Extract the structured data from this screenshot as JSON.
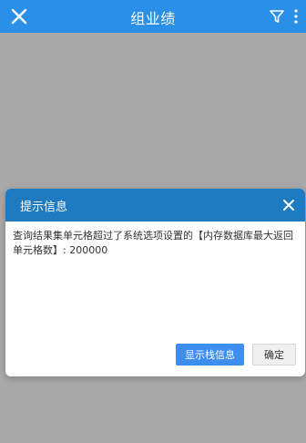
{
  "header": {
    "title": "组业绩",
    "background_color": "#2a8fe6",
    "left_icon": "close-icon",
    "right_icons": [
      "filter-icon",
      "more-vertical-icon"
    ]
  },
  "overlay": {
    "color": "#6e6e6e"
  },
  "dialog": {
    "title": "提示信息",
    "header_color": "#1e7bc2",
    "message": "查询结果集单元格超过了系统选项设置的【内存数据库最大返回单元格数】: 200000",
    "primary_button": "显示栈信息",
    "primary_button_color": "#3e8ef0",
    "secondary_button": "确定"
  }
}
